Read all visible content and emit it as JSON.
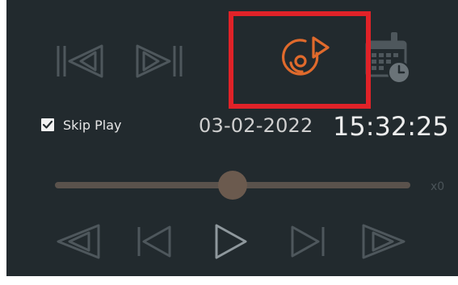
{
  "controls": {
    "skip_play_label": "Skip Play",
    "skip_play_checked": true,
    "date": "03-02-2022",
    "time": "15:32:25",
    "speed": "x0",
    "playback_position": 0.5
  },
  "icons": {
    "top_row": [
      "skip-to-start-icon",
      "skip-to-end-icon",
      "disc-play-icon",
      "calendar-clock-icon"
    ],
    "bottom_row": [
      "rewind-icon",
      "previous-frame-icon",
      "play-icon",
      "next-frame-icon",
      "fast-forward-icon"
    ]
  },
  "colors": {
    "background": "#222a2e",
    "icon_idle": "#4e575c",
    "accent": "#e06a2c",
    "highlight": "#e02228",
    "slider_track": "#5a524c",
    "slider_thumb": "#6b5a4e"
  }
}
